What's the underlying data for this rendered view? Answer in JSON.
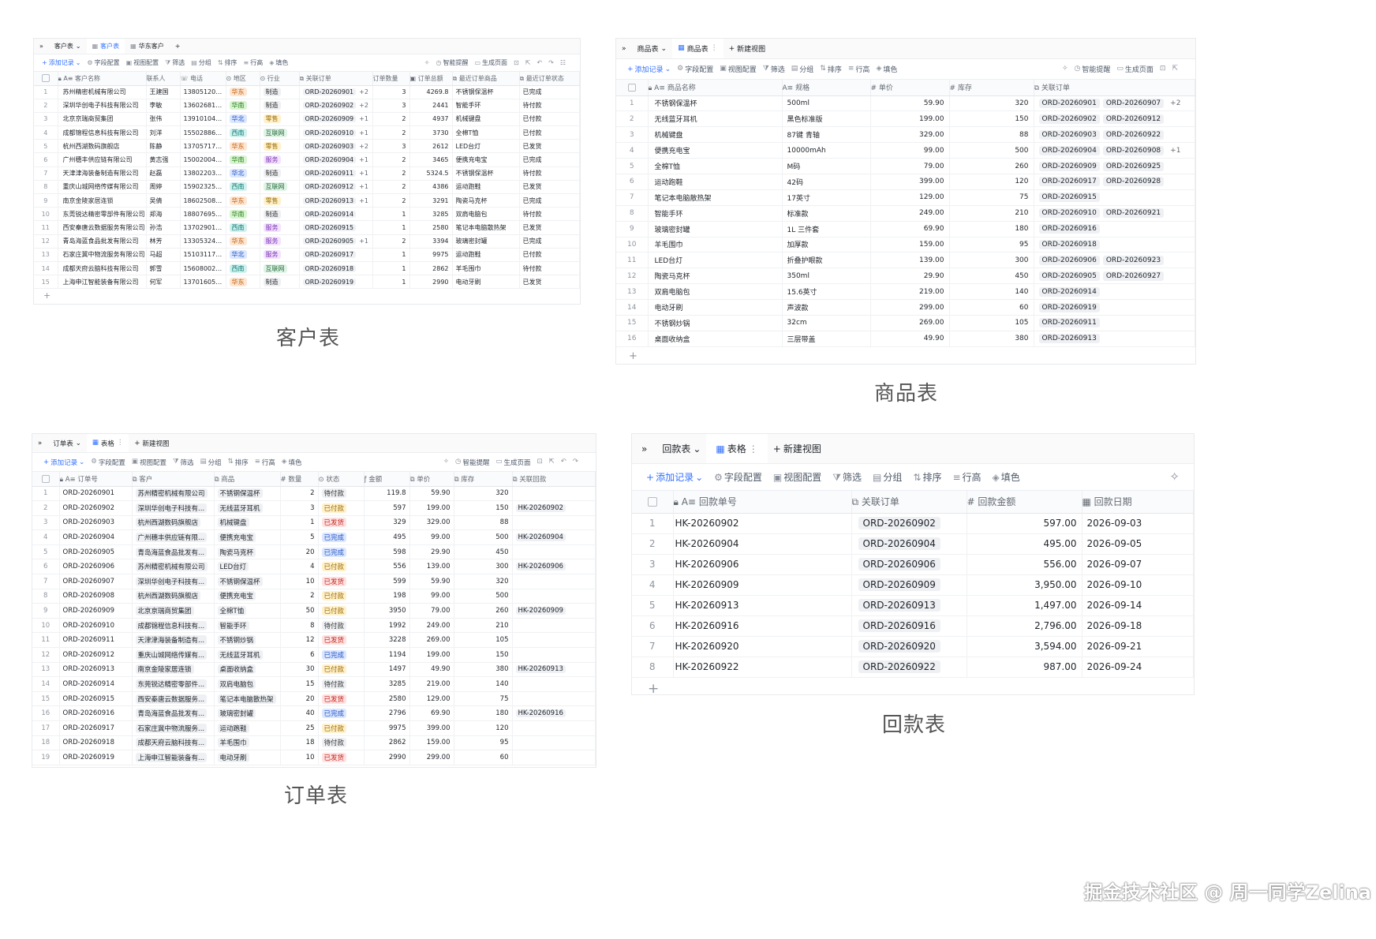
{
  "customer": {
    "tabs": {
      "nav": "»",
      "t1": "客户表",
      "t2": "客户表",
      "t3": "华东客户",
      "add": "+"
    },
    "toolbar": {
      "add": "添加记录",
      "field": "字段配置",
      "view": "视图配置",
      "filter": "筛选",
      "group": "分组",
      "sort": "排序",
      "height": "行高",
      "fill": "填色",
      "smart": "智能提醒",
      "page": "生成页面"
    },
    "headers": [
      "客户名称",
      "联系人",
      "电话",
      "地区",
      "行业",
      "关联订单",
      "订单数量",
      "订单总额",
      "最近订单商品",
      "最近订单状态"
    ],
    "rows": [
      [
        "1",
        "苏州精密机械有限公司",
        "王建国",
        "13805120031",
        "华东",
        "制造",
        "ORD-20260901",
        "+2",
        "3",
        "4269.8",
        "不锈钢保温杯",
        "已完成"
      ],
      [
        "2",
        "深圳华创电子科技有限公司",
        "李敏",
        "13602681275",
        "华南",
        "制造",
        "ORD-20260902",
        "+2",
        "3",
        "2441",
        "智能手环",
        "待付款"
      ],
      [
        "3",
        "北京京瑞商贸集团",
        "张伟",
        "13910104582",
        "华北",
        "零售",
        "ORD-20260909",
        "+1",
        "2",
        "4937",
        "机械键盘",
        "已付款"
      ],
      [
        "4",
        "成都锦程信息科技有限公司",
        "刘洋",
        "15502886319",
        "西南",
        "互联网",
        "ORD-20260910",
        "+1",
        "2",
        "3730",
        "全棉T恤",
        "已付款"
      ],
      [
        "5",
        "杭州西湖数码旗舰店",
        "陈静",
        "13705717024",
        "华东",
        "零售",
        "ORD-20260903",
        "+2",
        "3",
        "2612",
        "LED台灯",
        "已发货"
      ],
      [
        "6",
        "广州穗丰供应链有限公司",
        "黄志强",
        "15002004816",
        "华南",
        "服务",
        "ORD-20260904",
        "+1",
        "2",
        "3465",
        "便携充电宝",
        "已完成"
      ],
      [
        "7",
        "天津津海装备制造有限公司",
        "赵磊",
        "13802203694",
        "华北",
        "制造",
        "ORD-20260911",
        "+1",
        "2",
        "5324.5",
        "不锈钢保温杯",
        "待付款"
      ],
      [
        "8",
        "重庆山城网络传媒有限公司",
        "周婷",
        "15902325207",
        "西南",
        "互联网",
        "ORD-20260912",
        "+1",
        "2",
        "4386",
        "运动跑鞋",
        "已发货"
      ],
      [
        "9",
        "南京金陵家居连锁",
        "吴倩",
        "18602508163",
        "华东",
        "零售",
        "ORD-20260913",
        "+1",
        "2",
        "3291",
        "陶瓷马克杯",
        "已完成"
      ],
      [
        "10",
        "东莞锐达精密零部件有限公司",
        "郑海",
        "18807695238",
        "华南",
        "制造",
        "ORD-20260914",
        "",
        "1",
        "3285",
        "双肩电脑包",
        "待付款"
      ],
      [
        "11",
        "西安秦唐云数据服务有限公司",
        "孙浩",
        "13702901875",
        "西南",
        "服务",
        "ORD-20260915",
        "",
        "1",
        "2580",
        "笔记本电脑散热架",
        "已发货"
      ],
      [
        "12",
        "青岛海蓝食品批发有限公司",
        "林芳",
        "13305324619",
        "华东",
        "服务",
        "ORD-20260905",
        "+1",
        "2",
        "3394",
        "玻璃密封罐",
        "已完成"
      ],
      [
        "13",
        "石家庄冀中物流服务有限公司",
        "马超",
        "15103117642",
        "华北",
        "服务",
        "ORD-20260917",
        "",
        "1",
        "9975",
        "运动跑鞋",
        "已付款"
      ],
      [
        "14",
        "成都天府云脑科技有限公司",
        "郭雪",
        "15608002937",
        "西南",
        "互联网",
        "ORD-20260918",
        "",
        "1",
        "2862",
        "羊毛围巾",
        "待付款"
      ],
      [
        "15",
        "上海申江智能装备有限公司",
        "何军",
        "13701605804",
        "华东",
        "制造",
        "ORD-20260919",
        "",
        "1",
        "2990",
        "电动牙刷",
        "已发货"
      ]
    ],
    "add_row": "+",
    "caption": "客户表"
  },
  "product": {
    "tabs": {
      "nav": "»",
      "t1": "商品表",
      "t2": "商品表",
      "new": "新建视图"
    },
    "toolbar": {
      "add": "添加记录",
      "field": "字段配置",
      "view": "视图配置",
      "filter": "筛选",
      "group": "分组",
      "sort": "排序",
      "height": "行高",
      "fill": "填色",
      "smart": "智能提醒",
      "page": "生成页面"
    },
    "headers": [
      "商品名称",
      "规格",
      "单价",
      "库存",
      "关联订单"
    ],
    "rows": [
      [
        "1",
        "不锈钢保温杯",
        "500ml",
        "59.90",
        "320",
        "ORD-20260901",
        "ORD-20260907",
        "+2"
      ],
      [
        "2",
        "无线蓝牙耳机",
        "黑色标准版",
        "199.00",
        "150",
        "ORD-20260902",
        "ORD-20260912",
        ""
      ],
      [
        "3",
        "机械键盘",
        "87键 青轴",
        "329.00",
        "88",
        "ORD-20260903",
        "ORD-20260922",
        ""
      ],
      [
        "4",
        "便携充电宝",
        "10000mAh",
        "99.00",
        "500",
        "ORD-20260904",
        "ORD-20260908",
        "+1"
      ],
      [
        "5",
        "全棉T恤",
        "M码",
        "79.00",
        "260",
        "ORD-20260909",
        "ORD-20260925",
        ""
      ],
      [
        "6",
        "运动跑鞋",
        "42码",
        "399.00",
        "120",
        "ORD-20260917",
        "ORD-20260928",
        ""
      ],
      [
        "7",
        "笔记本电脑散热架",
        "17英寸",
        "129.00",
        "75",
        "ORD-20260915",
        "",
        ""
      ],
      [
        "8",
        "智能手环",
        "标准款",
        "249.00",
        "210",
        "ORD-20260910",
        "ORD-20260921",
        ""
      ],
      [
        "9",
        "玻璃密封罐",
        "1L 三件套",
        "69.90",
        "180",
        "ORD-20260916",
        "",
        ""
      ],
      [
        "10",
        "羊毛围巾",
        "加厚款",
        "159.00",
        "95",
        "ORD-20260918",
        "",
        ""
      ],
      [
        "11",
        "LED台灯",
        "折叠护眼款",
        "139.00",
        "300",
        "ORD-20260906",
        "ORD-20260923",
        ""
      ],
      [
        "12",
        "陶瓷马克杯",
        "350ml",
        "29.90",
        "450",
        "ORD-20260905",
        "ORD-20260927",
        ""
      ],
      [
        "13",
        "双肩电脑包",
        "15.6英寸",
        "219.00",
        "140",
        "ORD-20260914",
        "",
        ""
      ],
      [
        "14",
        "电动牙刷",
        "声波款",
        "299.00",
        "60",
        "ORD-20260919",
        "",
        ""
      ],
      [
        "15",
        "不锈钢炒锅",
        "32cm",
        "269.00",
        "105",
        "ORD-20260911",
        "",
        ""
      ],
      [
        "16",
        "桌面收纳盒",
        "三层带盖",
        "49.90",
        "380",
        "ORD-20260913",
        "",
        ""
      ]
    ],
    "add_row": "+",
    "caption": "商品表"
  },
  "order": {
    "tabs": {
      "nav": "»",
      "t1": "订单表",
      "t2": "表格",
      "new": "新建视图"
    },
    "toolbar": {
      "add": "添加记录",
      "field": "字段配置",
      "view": "视图配置",
      "filter": "筛选",
      "group": "分组",
      "sort": "排序",
      "height": "行高",
      "fill": "填色",
      "smart": "智能提醒",
      "page": "生成页面"
    },
    "headers": [
      "订单号",
      "客户",
      "商品",
      "数量",
      "状态",
      "金额",
      "单价",
      "库存",
      "关联回款"
    ],
    "rows": [
      [
        "1",
        "ORD-20260901",
        "苏州精密机械有限公司",
        "不锈钢保温杯",
        "2",
        "待付款",
        "119.8",
        "59.90",
        "320",
        ""
      ],
      [
        "2",
        "ORD-20260902",
        "深圳华创电子科技有...",
        "无线蓝牙耳机",
        "3",
        "已付款",
        "597",
        "199.00",
        "150",
        "HK-20260902"
      ],
      [
        "3",
        "ORD-20260903",
        "杭州西湖数码旗舰店",
        "机械键盘",
        "1",
        "已发货",
        "329",
        "329.00",
        "88",
        ""
      ],
      [
        "4",
        "ORD-20260904",
        "广州穗丰供应链有限...",
        "便携充电宝",
        "5",
        "已完成",
        "495",
        "99.00",
        "500",
        "HK-20260904"
      ],
      [
        "5",
        "ORD-20260905",
        "青岛海蓝食品批发有...",
        "陶瓷马克杯",
        "20",
        "已完成",
        "598",
        "29.90",
        "450",
        ""
      ],
      [
        "6",
        "ORD-20260906",
        "苏州精密机械有限公司",
        "LED台灯",
        "4",
        "已付款",
        "556",
        "139.00",
        "300",
        "HK-20260906"
      ],
      [
        "7",
        "ORD-20260907",
        "深圳华创电子科技有...",
        "不锈钢保温杯",
        "10",
        "已发货",
        "599",
        "59.90",
        "320",
        ""
      ],
      [
        "8",
        "ORD-20260908",
        "杭州西湖数码旗舰店",
        "便携充电宝",
        "2",
        "已付款",
        "198",
        "99.00",
        "500",
        ""
      ],
      [
        "9",
        "ORD-20260909",
        "北京京瑞商贸集团",
        "全棉T恤",
        "50",
        "已付款",
        "3950",
        "79.00",
        "260",
        "HK-20260909"
      ],
      [
        "10",
        "ORD-20260910",
        "成都锦程信息科技有...",
        "智能手环",
        "8",
        "待付款",
        "1992",
        "249.00",
        "210",
        ""
      ],
      [
        "11",
        "ORD-20260911",
        "天津津海装备制造有...",
        "不锈钢炒锅",
        "12",
        "已发货",
        "3228",
        "269.00",
        "105",
        ""
      ],
      [
        "12",
        "ORD-20260912",
        "重庆山城网络传媒有...",
        "无线蓝牙耳机",
        "6",
        "已完成",
        "1194",
        "199.00",
        "150",
        ""
      ],
      [
        "13",
        "ORD-20260913",
        "南京金陵家居连锁",
        "桌面收纳盒",
        "30",
        "已付款",
        "1497",
        "49.90",
        "380",
        "HK-20260913"
      ],
      [
        "14",
        "ORD-20260914",
        "东莞锐达精密零部件...",
        "双肩电脑包",
        "15",
        "待付款",
        "3285",
        "219.00",
        "140",
        ""
      ],
      [
        "15",
        "ORD-20260915",
        "西安秦唐云数据服务...",
        "笔记本电脑散热架",
        "20",
        "已发货",
        "2580",
        "129.00",
        "75",
        ""
      ],
      [
        "16",
        "ORD-20260916",
        "青岛海蓝食品批发有...",
        "玻璃密封罐",
        "40",
        "已完成",
        "2796",
        "69.90",
        "180",
        "HK-20260916"
      ],
      [
        "17",
        "ORD-20260917",
        "石家庄冀中物流服务...",
        "运动跑鞋",
        "25",
        "已付款",
        "9975",
        "399.00",
        "120",
        ""
      ],
      [
        "18",
        "ORD-20260918",
        "成都天府云脑科技有...",
        "羊毛围巾",
        "18",
        "待付款",
        "2862",
        "159.00",
        "95",
        ""
      ],
      [
        "19",
        "ORD-20260919",
        "上海申江智能装备有...",
        "电动牙刷",
        "10",
        "已发货",
        "2990",
        "299.00",
        "60",
        ""
      ]
    ],
    "caption": "订单表"
  },
  "payment": {
    "tabs": {
      "nav": "»",
      "t1": "回款表",
      "t2": "表格",
      "new": "新建视图"
    },
    "toolbar": {
      "add": "添加记录",
      "field": "字段配置",
      "view": "视图配置",
      "filter": "筛选",
      "group": "分组",
      "sort": "排序",
      "height": "行高",
      "fill": "填色"
    },
    "headers": [
      "回款单号",
      "关联订单",
      "回款金额",
      "回款日期"
    ],
    "rows": [
      [
        "1",
        "HK-20260902",
        "ORD-20260902",
        "597.00",
        "2026-09-03"
      ],
      [
        "2",
        "HK-20260904",
        "ORD-20260904",
        "495.00",
        "2026-09-05"
      ],
      [
        "3",
        "HK-20260906",
        "ORD-20260906",
        "556.00",
        "2026-09-07"
      ],
      [
        "4",
        "HK-20260909",
        "ORD-20260909",
        "3,950.00",
        "2026-09-10"
      ],
      [
        "5",
        "HK-20260913",
        "ORD-20260913",
        "1,497.00",
        "2026-09-14"
      ],
      [
        "6",
        "HK-20260916",
        "ORD-20260916",
        "2,796.00",
        "2026-09-18"
      ],
      [
        "7",
        "HK-20260920",
        "ORD-20260920",
        "3,594.00",
        "2026-09-21"
      ],
      [
        "8",
        "HK-20260922",
        "ORD-20260922",
        "987.00",
        "2026-09-24"
      ]
    ],
    "add_row": "+",
    "caption": "回款表"
  },
  "tag_colors": {
    "华东": [
      "#fde7d3",
      "#c45a0b"
    ],
    "华南": [
      "#d7f5d0",
      "#2e7d1d"
    ],
    "华北": [
      "#dbe6ff",
      "#2356c4"
    ],
    "西南": [
      "#d0f2ef",
      "#0d7a70"
    ],
    "制造": [
      "#eef0f3",
      "#333"
    ],
    "零售": [
      "#fff1cc",
      "#9a6a00"
    ],
    "互联网": [
      "#e1f3e6",
      "#1f6b3a"
    ],
    "服务": [
      "#f3e3ff",
      "#7a2fb0"
    ],
    "待付款": [
      "#eef0f3",
      "#333"
    ],
    "已付款": [
      "#fff1cc",
      "#9a6a00"
    ],
    "已发货": [
      "#ffe1e1",
      "#c0261d"
    ],
    "已完成": [
      "#dbe6ff",
      "#2356c4"
    ]
  },
  "watermark": "掘金技术社区 @ 周一同学Zelina"
}
